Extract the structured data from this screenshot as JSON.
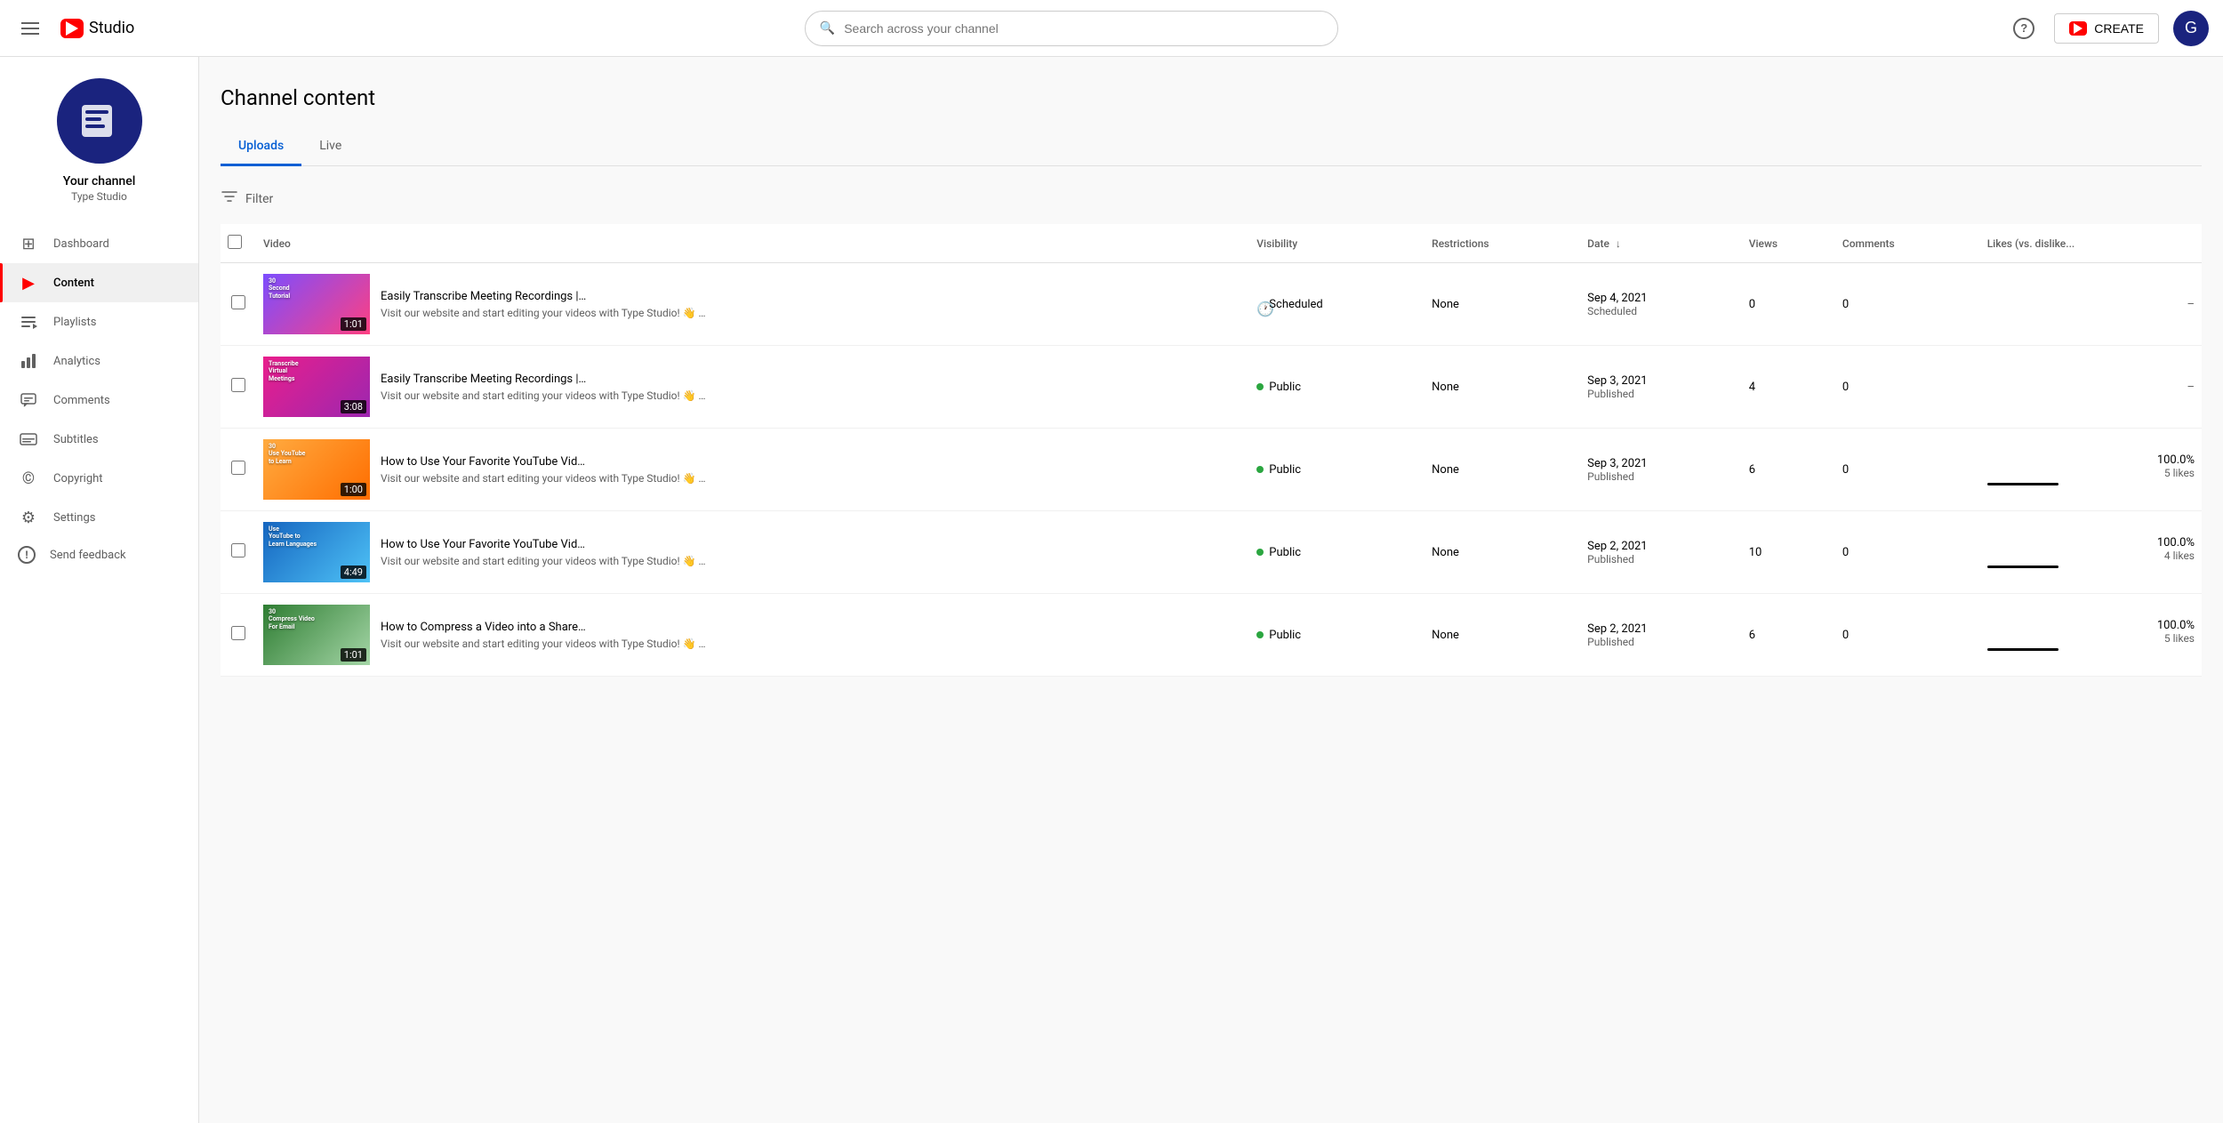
{
  "header": {
    "menu_icon": "☰",
    "logo_text": "Studio",
    "search_placeholder": "Search across your channel",
    "help_icon": "?",
    "create_label": "CREATE",
    "avatar_icon": "G"
  },
  "sidebar": {
    "channel_name": "Your channel",
    "channel_sub": "Type Studio",
    "avatar_glyph": "G",
    "nav_items": [
      {
        "id": "dashboard",
        "label": "Dashboard",
        "icon": "⊞"
      },
      {
        "id": "content",
        "label": "Content",
        "icon": "▶",
        "active": true
      },
      {
        "id": "playlists",
        "label": "Playlists",
        "icon": "≡"
      },
      {
        "id": "analytics",
        "label": "Analytics",
        "icon": "▦"
      },
      {
        "id": "comments",
        "label": "Comments",
        "icon": "💬"
      },
      {
        "id": "subtitles",
        "label": "Subtitles",
        "icon": "≡"
      },
      {
        "id": "copyright",
        "label": "Copyright",
        "icon": "©"
      },
      {
        "id": "settings",
        "label": "Settings",
        "icon": "⚙"
      },
      {
        "id": "feedback",
        "label": "Send feedback",
        "icon": "!"
      }
    ]
  },
  "page": {
    "title": "Channel content",
    "tabs": [
      {
        "id": "uploads",
        "label": "Uploads",
        "active": true
      },
      {
        "id": "live",
        "label": "Live",
        "active": false
      }
    ],
    "filter_label": "Filter"
  },
  "table": {
    "columns": [
      {
        "id": "video",
        "label": "Video"
      },
      {
        "id": "visibility",
        "label": "Visibility"
      },
      {
        "id": "restrictions",
        "label": "Restrictions"
      },
      {
        "id": "date",
        "label": "Date",
        "sortable": true
      },
      {
        "id": "views",
        "label": "Views"
      },
      {
        "id": "comments",
        "label": "Comments"
      },
      {
        "id": "likes",
        "label": "Likes (vs. dislike..."
      }
    ],
    "rows": [
      {
        "id": "row1",
        "title": "Easily Transcribe Meeting Recordings |…",
        "desc": "Visit our website and start editing your videos with Type Studio! 👋 …",
        "visibility": "Scheduled",
        "visibility_type": "scheduled",
        "restrictions": "None",
        "date_main": "Sep 4, 2021",
        "date_sub": "Scheduled",
        "views": "0",
        "comments": "0",
        "likes_pct": "",
        "likes_count": "",
        "likes_bar": 0,
        "duration": "1:01",
        "thumb_class": "thumb-purple",
        "thumb_label1": "30",
        "thumb_label2": "Second",
        "thumb_label3": "Tutorial"
      },
      {
        "id": "row2",
        "title": "Easily Transcribe Meeting Recordings |…",
        "desc": "Visit our website and start editing your videos with Type Studio! 👋 …",
        "visibility": "Public",
        "visibility_type": "public",
        "restrictions": "None",
        "date_main": "Sep 3, 2021",
        "date_sub": "Published",
        "views": "4",
        "comments": "0",
        "likes_pct": "",
        "likes_count": "",
        "likes_bar": 0,
        "duration": "3:08",
        "thumb_class": "thumb-pink",
        "thumb_label1": "Transcribe",
        "thumb_label2": "Virtual",
        "thumb_label3": "Meetings"
      },
      {
        "id": "row3",
        "title": "How to Use Your Favorite YouTube Vid…",
        "desc": "Visit our website and start editing your videos with Type Studio! 👋 …",
        "visibility": "Public",
        "visibility_type": "public",
        "restrictions": "None",
        "date_main": "Sep 3, 2021",
        "date_sub": "Published",
        "views": "6",
        "comments": "0",
        "likes_pct": "100.0%",
        "likes_count": "5 likes",
        "likes_bar": 100,
        "duration": "1:00",
        "thumb_class": "thumb-yellow",
        "thumb_label1": "30",
        "thumb_label2": "Use YouTube",
        "thumb_label3": "to Learn"
      },
      {
        "id": "row4",
        "title": "How to Use Your Favorite YouTube Vid…",
        "desc": "Visit our website and start editing your videos with Type Studio! 👋 …",
        "visibility": "Public",
        "visibility_type": "public",
        "restrictions": "None",
        "date_main": "Sep 2, 2021",
        "date_sub": "Published",
        "views": "10",
        "comments": "0",
        "likes_pct": "100.0%",
        "likes_count": "4 likes",
        "likes_bar": 100,
        "duration": "4:49",
        "thumb_class": "thumb-blue",
        "thumb_label1": "Use",
        "thumb_label2": "YouTube to",
        "thumb_label3": "Learn Languages"
      },
      {
        "id": "row5",
        "title": "How to Compress a Video into a Share…",
        "desc": "Visit our website and start editing your videos with Type Studio! 👋 …",
        "visibility": "Public",
        "visibility_type": "public",
        "restrictions": "None",
        "date_main": "Sep 2, 2021",
        "date_sub": "Published",
        "views": "6",
        "comments": "0",
        "likes_pct": "100.0%",
        "likes_count": "5 likes",
        "likes_bar": 100,
        "duration": "1:01",
        "thumb_class": "thumb-green",
        "thumb_label1": "30",
        "thumb_label2": "Compress Video",
        "thumb_label3": "For Email"
      }
    ]
  }
}
